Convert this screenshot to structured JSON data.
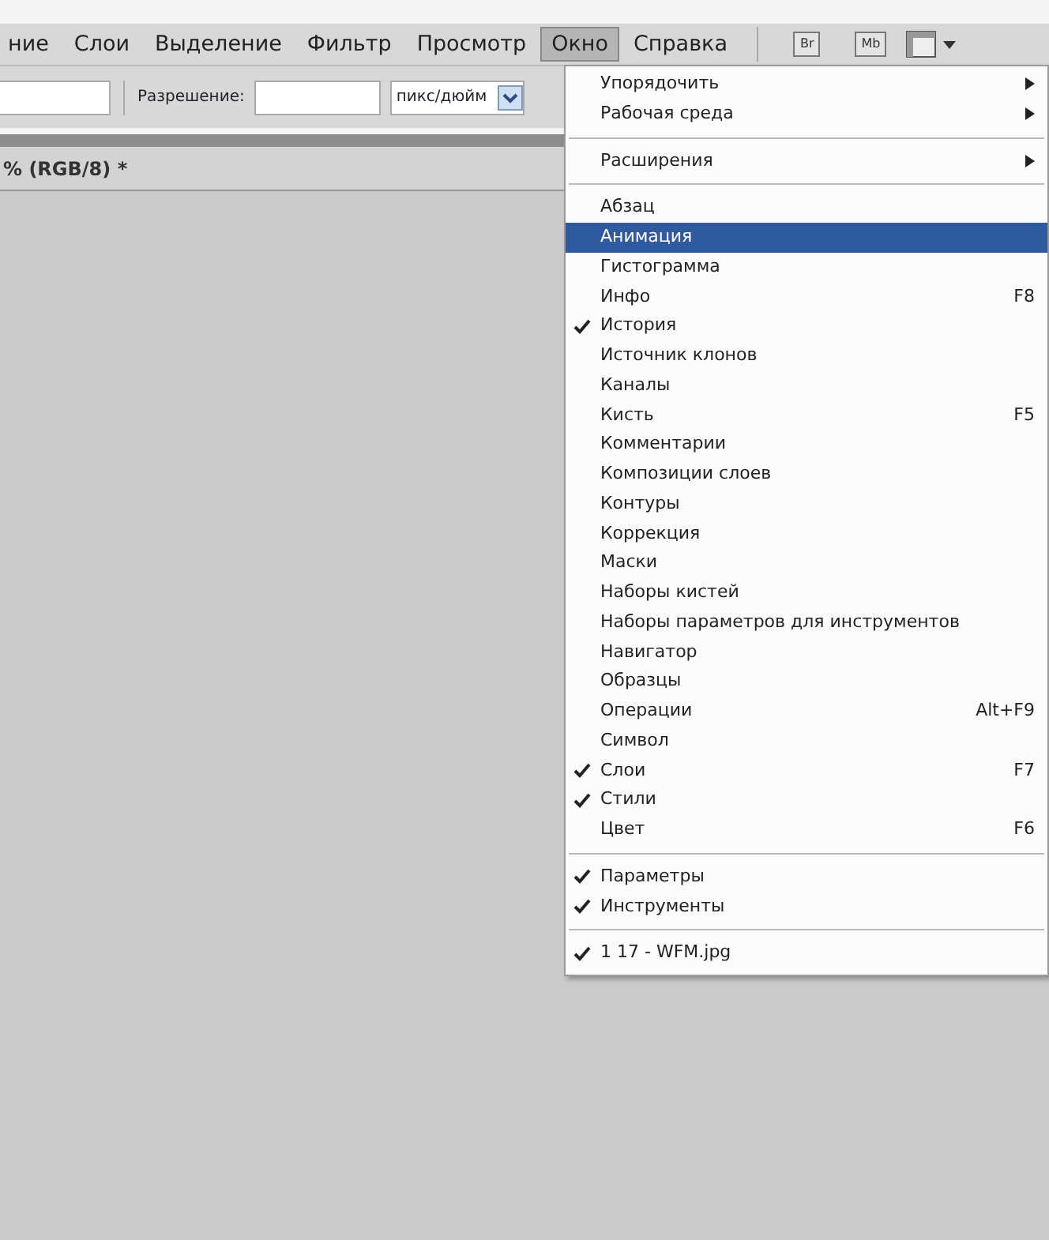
{
  "menu_bar": [
    {
      "label": "ние",
      "selected": false
    },
    {
      "label": "Слои",
      "selected": false
    },
    {
      "label": "Выделение",
      "selected": false
    },
    {
      "label": "Фильтр",
      "selected": false
    },
    {
      "label": "Просмотр",
      "selected": false
    },
    {
      "label": "Окно",
      "selected": true
    },
    {
      "label": "Справка",
      "selected": false
    }
  ],
  "app_buttons": [
    "Br",
    "Mb"
  ],
  "options_bar": {
    "resolution_label": "Разрешение:",
    "unit": "пикс/дюйм"
  },
  "document_tab": {
    "title": "% (RGB/8) *"
  },
  "window_menu": {
    "sections": [
      [
        {
          "label": "Упорядочить",
          "checked": false,
          "selected": false,
          "submenu": true
        },
        {
          "label": "Рабочая среда",
          "checked": false,
          "selected": false,
          "submenu": true
        }
      ],
      [
        {
          "label": "Расширения",
          "checked": false,
          "selected": false,
          "submenu": true
        }
      ],
      [
        {
          "label": "Абзац",
          "checked": false,
          "selected": false,
          "submenu": false
        },
        {
          "label": "Анимация",
          "checked": false,
          "selected": true,
          "submenu": false
        },
        {
          "label": "Гистограмма",
          "checked": false,
          "selected": false,
          "submenu": false
        },
        {
          "label": "Инфо",
          "shortcut": "F8",
          "checked": false,
          "selected": false,
          "submenu": false
        },
        {
          "label": "История",
          "checked": true,
          "selected": false,
          "submenu": false
        },
        {
          "label": "Источник клонов",
          "checked": false,
          "selected": false,
          "submenu": false
        },
        {
          "label": "Каналы",
          "checked": false,
          "selected": false,
          "submenu": false
        },
        {
          "label": "Кисть",
          "shortcut": "F5",
          "checked": false,
          "selected": false,
          "submenu": false
        },
        {
          "label": "Комментарии",
          "checked": false,
          "selected": false,
          "submenu": false
        },
        {
          "label": "Композиции слоев",
          "checked": false,
          "selected": false,
          "submenu": false
        },
        {
          "label": "Контуры",
          "checked": false,
          "selected": false,
          "submenu": false
        },
        {
          "label": "Коррекция",
          "checked": false,
          "selected": false,
          "submenu": false
        },
        {
          "label": "Маски",
          "checked": false,
          "selected": false,
          "submenu": false
        },
        {
          "label": "Наборы кистей",
          "checked": false,
          "selected": false,
          "submenu": false
        },
        {
          "label": "Наборы параметров для инструментов",
          "checked": false,
          "selected": false,
          "submenu": false
        },
        {
          "label": "Навигатор",
          "checked": false,
          "selected": false,
          "submenu": false
        },
        {
          "label": "Образцы",
          "checked": false,
          "selected": false,
          "submenu": false
        },
        {
          "label": "Операции",
          "shortcut": "Alt+F9",
          "checked": false,
          "selected": false,
          "submenu": false
        },
        {
          "label": "Символ",
          "checked": false,
          "selected": false,
          "submenu": false
        },
        {
          "label": "Слои",
          "shortcut": "F7",
          "checked": true,
          "selected": false,
          "submenu": false
        },
        {
          "label": "Стили",
          "checked": true,
          "selected": false,
          "submenu": false
        },
        {
          "label": "Цвет",
          "shortcut": "F6",
          "checked": false,
          "selected": false,
          "submenu": false
        }
      ],
      [
        {
          "label": "Параметры",
          "checked": true,
          "selected": false,
          "submenu": false
        },
        {
          "label": "Инструменты",
          "checked": true,
          "selected": false,
          "submenu": false
        }
      ],
      [
        {
          "label": "1 17 - WFM.jpg",
          "checked": true,
          "selected": false,
          "submenu": false
        }
      ]
    ]
  }
}
